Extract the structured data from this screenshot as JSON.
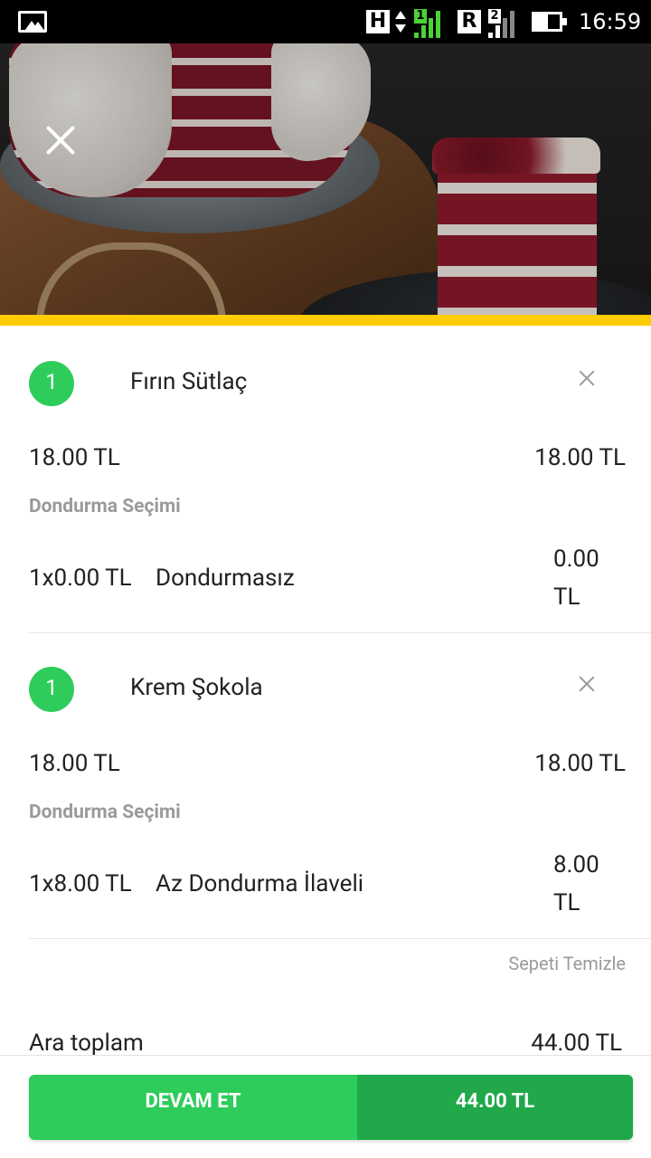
{
  "status_bar": {
    "network1": "H",
    "sim1": "1",
    "network2": "R",
    "sim2": "2",
    "time": "16:59",
    "icons": [
      "image-icon",
      "data-arrows-icon",
      "signal-icon",
      "battery-icon"
    ],
    "sim1_color": "#4cd137",
    "battery_level": 0.55
  },
  "hero": {
    "image": "red-velvet-cake-photo"
  },
  "colors": {
    "accent": "#ffcc00",
    "green": "#2ecc5b",
    "green_dark": "#20a84a"
  },
  "cart": {
    "items": [
      {
        "quantity": "1",
        "name": "Fırın Sütlaç",
        "unit_price": "18.00 TL",
        "total_price": "18.00 TL",
        "option_group": "Dondurma Seçimi",
        "option_qty": "1x0.00 TL",
        "option_name": "Dondurmasız",
        "option_price_line1": "0.00",
        "option_price_line2": "TL"
      },
      {
        "quantity": "1",
        "name": "Krem Şokola",
        "unit_price": "18.00 TL",
        "total_price": "18.00 TL",
        "option_group": "Dondurma Seçimi",
        "option_qty": "1x8.00 TL",
        "option_name": "Az Dondurma İlaveli",
        "option_price_line1": "8.00",
        "option_price_line2": "TL"
      }
    ],
    "clear_label": "Sepeti Temizle",
    "subtotal_label": "Ara toplam",
    "subtotal_value": "44.00 TL"
  },
  "checkout": {
    "continue_label": "DEVAM ET",
    "total": "44.00 TL"
  }
}
